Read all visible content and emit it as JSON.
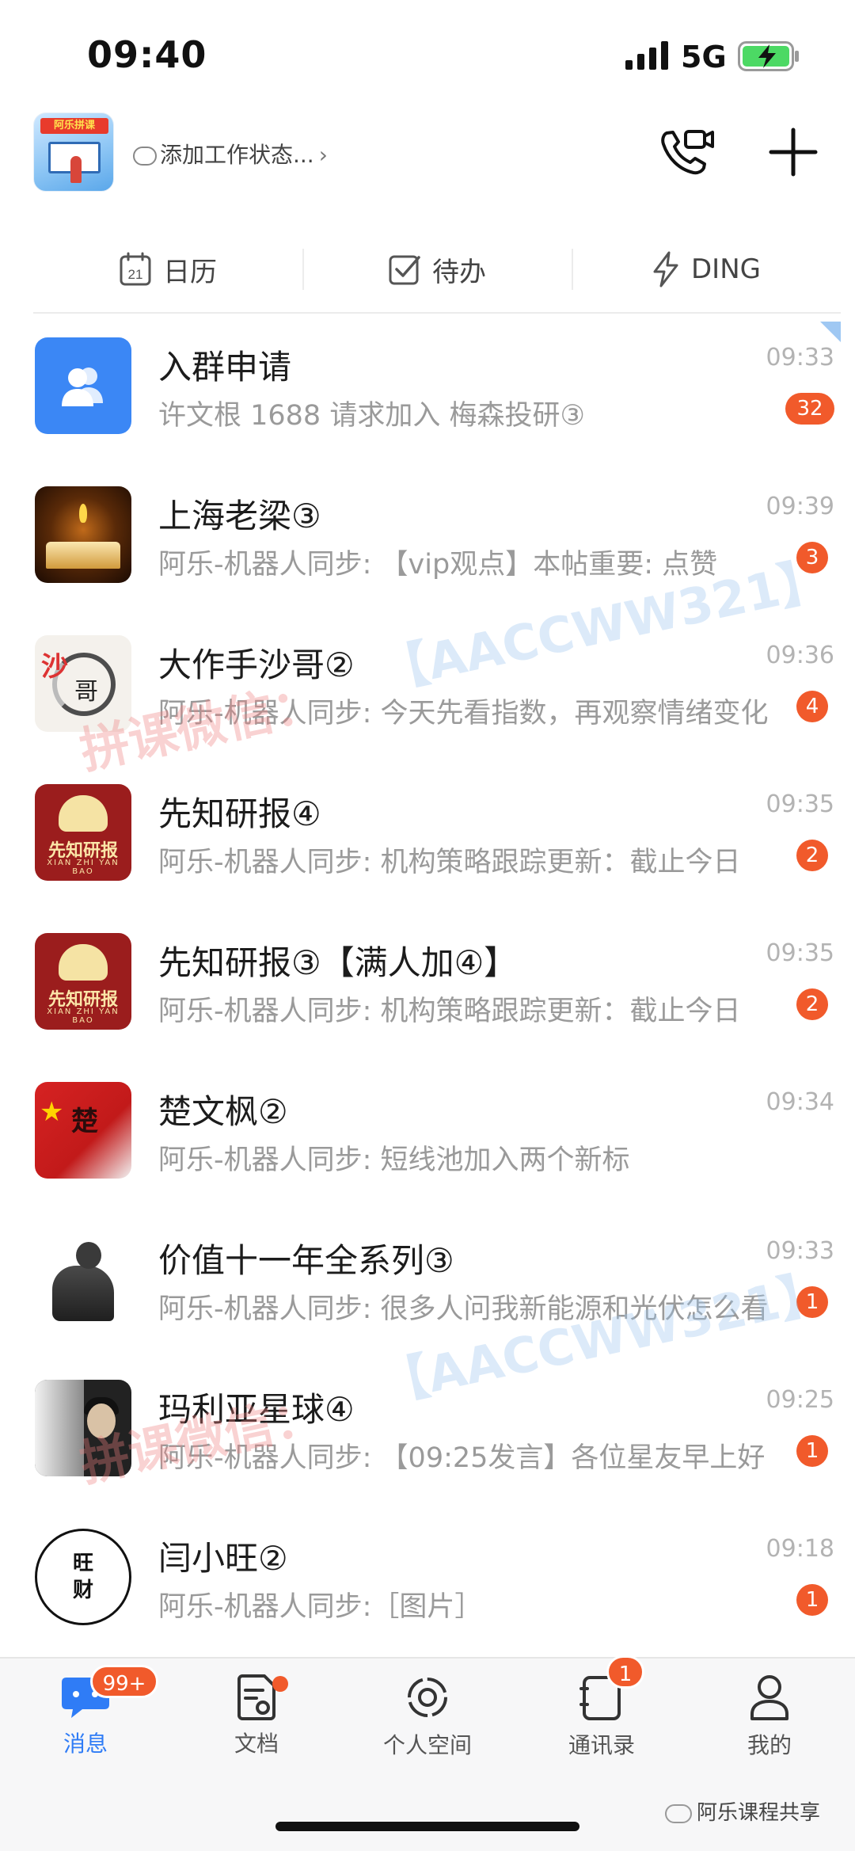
{
  "status_bar": {
    "time": "09:40",
    "network": "5G"
  },
  "header": {
    "org_logo_text": "阿乐拼课",
    "status_prompt": "添加工作状态...",
    "chevron": "›"
  },
  "shortcuts": [
    {
      "label": "日历",
      "icon": "calendar-icon",
      "calendar_day": "21"
    },
    {
      "label": "待办",
      "icon": "todo-check-icon"
    },
    {
      "label": "DING",
      "icon": "lightning-icon"
    }
  ],
  "chats": [
    {
      "name": "入群申请",
      "preview": "许文根 1688 请求加入 梅森投研③",
      "time": "09:33",
      "badge": "32",
      "avatar": "group-request"
    },
    {
      "name": "上海老梁③",
      "preview": "阿乐-机器人同步: 【vip观点】本帖重要: 点赞",
      "time": "09:39",
      "badge": "3",
      "avatar": "book"
    },
    {
      "name": "大作手沙哥②",
      "preview": "阿乐-机器人同步: 今天先看指数，再观察情绪变化",
      "time": "09:36",
      "badge": "4",
      "avatar": "ink"
    },
    {
      "name": "先知研报④",
      "preview": "阿乐-机器人同步: 机构策略跟踪更新：截止今日",
      "time": "09:35",
      "badge": "2",
      "avatar": "xianzhi"
    },
    {
      "name": "先知研报③【满人加④】",
      "preview": "阿乐-机器人同步: 机构策略跟踪更新：截止今日",
      "time": "09:35",
      "badge": "2",
      "avatar": "xianzhi"
    },
    {
      "name": "楚文枫②",
      "preview": "阿乐-机器人同步: 短线池加入两个新标",
      "time": "09:34",
      "badge": "",
      "avatar": "flag"
    },
    {
      "name": "价值十一年全系列③",
      "preview": "阿乐-机器人同步: 很多人问我新能源和光伏怎么看",
      "time": "09:33",
      "badge": "1",
      "avatar": "statue"
    },
    {
      "name": "玛利亚星球④",
      "preview": "阿乐-机器人同步: 【09:25发言】各位星友早上好",
      "time": "09:25",
      "badge": "1",
      "avatar": "photo"
    },
    {
      "name": "闫小旺②",
      "preview": "阿乐-机器人同步:［图片］",
      "time": "09:18",
      "badge": "1",
      "avatar": "wangcai"
    }
  ],
  "avatar_texts": {
    "xianzhi_main": "先知研报",
    "xianzhi_sub": "XIAN ZHI YAN BAO",
    "ink_seal": "沙",
    "ink_char": "哥",
    "flag_char": "楚",
    "wangcai_top": "旺",
    "wangcai_bottom": "财"
  },
  "watermarks": {
    "red": "拼课微信：",
    "blue": "【AACCWW321】"
  },
  "tabbar": {
    "tabs": [
      {
        "label": "消息",
        "badge": "99+"
      },
      {
        "label": "文档"
      },
      {
        "label": "个人空间"
      },
      {
        "label": "通讯录",
        "badge": "1"
      },
      {
        "label": "我的"
      }
    ],
    "public_account": "阿乐课程共享"
  },
  "colors": {
    "accent": "#2f7cf6",
    "badge": "#f15a2b",
    "preview_text": "#9a9a9a",
    "time_text": "#b3b3b3"
  }
}
